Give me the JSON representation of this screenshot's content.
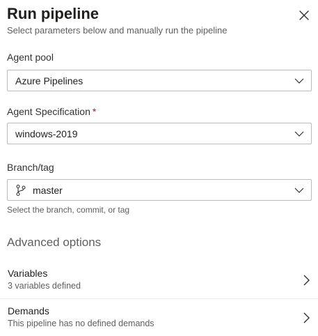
{
  "header": {
    "title": "Run pipeline",
    "subtitle": "Select parameters below and manually run the pipeline"
  },
  "fields": {
    "agent_pool": {
      "label": "Agent pool",
      "value": "Azure Pipelines"
    },
    "agent_spec": {
      "label": "Agent Specification",
      "required_mark": "*",
      "value": "windows-2019"
    },
    "branch": {
      "label": "Branch/tag",
      "value": "master",
      "helper": "Select the branch, commit, or tag"
    }
  },
  "advanced": {
    "title": "Advanced options",
    "items": [
      {
        "title": "Variables",
        "subtitle": "3 variables defined"
      },
      {
        "title": "Demands",
        "subtitle": "This pipeline has no defined demands"
      }
    ]
  },
  "icons": {
    "close": "close-icon",
    "dropdown": "chevron-down-icon",
    "branch": "git-branch-icon",
    "row": "chevron-right-icon"
  },
  "colors": {
    "required": "#c50f1f",
    "border": "#bebbb8",
    "muted_text": "#605e5c"
  }
}
